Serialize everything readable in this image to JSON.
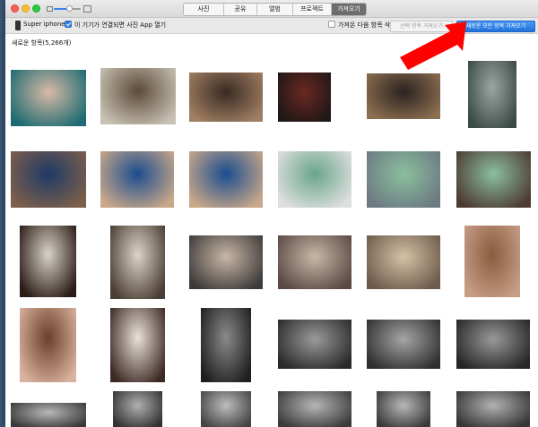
{
  "tabs": [
    "사진",
    "공유",
    "앨범",
    "프로젝트",
    "가져오기"
  ],
  "active_tab": "가져오기",
  "device": {
    "icon": "iphone-icon",
    "name": "Super iphone"
  },
  "open_photos_option": {
    "label": "이 기기가 연결되면 사진 App 열기",
    "checked": true
  },
  "delete_option": {
    "label": "가져온 다음 항목 삭제",
    "checked": false
  },
  "buttons": {
    "import_selected": "선택 항목 가져오기",
    "import_all": "새로운 모든 항목 가져오기"
  },
  "section": {
    "title": "새로운 항목(5,266개)"
  },
  "colors": {
    "accent_blue": "#2f7de1",
    "arrow_red": "#ff0000",
    "close": "#fc5f57",
    "minimize": "#fdbc2e",
    "maximize": "#2ac840"
  },
  "photos": [
    {
      "row": 1,
      "col": 1,
      "subject": "group photo of people in white costumes on a stage",
      "colors": [
        "#d9b9a6",
        "#1d6b72"
      ]
    },
    {
      "row": 1,
      "col": 2,
      "subject": "person holding a large white teddy bear in a room",
      "colors": [
        "#5d4a38",
        "#c7c1b3"
      ]
    },
    {
      "row": 1,
      "col": 3,
      "subject": "woman with curly hair in a dark setting",
      "colors": [
        "#3a2a22",
        "#a07f63"
      ]
    },
    {
      "row": 1,
      "col": 4,
      "subject": "man in dark clothes standing by a red door",
      "colors": [
        "#6a2822",
        "#1f1717"
      ]
    },
    {
      "row": 1,
      "col": 5,
      "subject": "two people at a dark restaurant table with lamps",
      "colors": [
        "#2b2220",
        "#8c6e50"
      ]
    },
    {
      "row": 1,
      "col": 6,
      "subject": "woman posing by a pool outdoors",
      "colors": [
        "#9aa6a2",
        "#3c4a45"
      ]
    },
    {
      "row": 2,
      "col": 1,
      "subject": "man at a desk eating from a red bowl",
      "colors": [
        "#1f3a66",
        "#7d5f4b"
      ]
    },
    {
      "row": 2,
      "col": 2,
      "subject": "man in blue jacket eating from a red bowl",
      "colors": [
        "#1a4d8f",
        "#c9a789"
      ]
    },
    {
      "row": 2,
      "col": 3,
      "subject": "man in blue jacket eating from a red bowl",
      "colors": [
        "#1a4d8f",
        "#c9a789"
      ]
    },
    {
      "row": 2,
      "col": 4,
      "subject": "woman with a green face mask and man selfie",
      "colors": [
        "#6aa58b",
        "#dfdfdf"
      ]
    },
    {
      "row": 2,
      "col": 5,
      "subject": "couple selfie, woman wearing green face mask",
      "colors": [
        "#8bbf9e",
        "#6c7a82"
      ]
    },
    {
      "row": 2,
      "col": 6,
      "subject": "couple selfie, woman wearing green face mask",
      "colors": [
        "#8bbf9e",
        "#4d3a33"
      ]
    },
    {
      "row": 3,
      "col": 1,
      "subject": "woman holding a bouquet of flowers",
      "colors": [
        "#d8d3c8",
        "#2b1c16"
      ]
    },
    {
      "row": 3,
      "col": 2,
      "subject": "person holding a large pastel bouquet",
      "colors": [
        "#dcd4c6",
        "#4a3d33"
      ]
    },
    {
      "row": 3,
      "col": 3,
      "subject": "close-up of pastel rose bouquet with baby's breath",
      "colors": [
        "#c9b7a6",
        "#3d3b3a"
      ]
    },
    {
      "row": 3,
      "col": 4,
      "subject": "close-up of pastel rose bouquet with baby's breath",
      "colors": [
        "#c9b7a6",
        "#5a4944"
      ]
    },
    {
      "row": 3,
      "col": 5,
      "subject": "close-up of pastel rose bouquet with baby's breath",
      "colors": [
        "#d6c2a5",
        "#6d5a4b"
      ]
    },
    {
      "row": 3,
      "col": 6,
      "subject": "woman with long wavy hair selfie",
      "colors": [
        "#8a5c3f",
        "#c79d86"
      ]
    },
    {
      "row": 4,
      "col": 1,
      "subject": "close-up selfie of a woman with long brown hair",
      "colors": [
        "#6b3e2d",
        "#d8b29c"
      ]
    },
    {
      "row": 4,
      "col": 2,
      "subject": "couple selfie in front of a white wall",
      "colors": [
        "#e9e2d8",
        "#3d2a24"
      ]
    },
    {
      "row": 4,
      "col": 3,
      "subject": "black and white photo of a woman in a room",
      "colors": [
        "#8a8a8a",
        "#1f1f1f"
      ]
    },
    {
      "row": 4,
      "col": 4,
      "subject": "black and white photo of a couple sitting",
      "colors": [
        "#9a9a9a",
        "#2a2a2a"
      ]
    },
    {
      "row": 4,
      "col": 5,
      "subject": "black and white photo of a couple in a room",
      "colors": [
        "#a5a5a5",
        "#2f2f2f"
      ]
    },
    {
      "row": 4,
      "col": 6,
      "subject": "black and white photo of a couple sitting",
      "colors": [
        "#999999",
        "#262626"
      ]
    },
    {
      "row": 5,
      "col": 1,
      "subject": "black and white photo of a group",
      "colors": [
        "#b8b8b8",
        "#3a3a3a"
      ]
    },
    {
      "row": 5,
      "col": 2,
      "subject": "black and white photo of a couple",
      "colors": [
        "#b0b0b0",
        "#333333"
      ]
    },
    {
      "row": 5,
      "col": 3,
      "subject": "black and white photo of a room",
      "colors": [
        "#bdbdbd",
        "#444444"
      ]
    },
    {
      "row": 5,
      "col": 4,
      "subject": "black and white photo of a room",
      "colors": [
        "#b6b6b6",
        "#3b3b3b"
      ]
    },
    {
      "row": 5,
      "col": 5,
      "subject": "black and white photo of people",
      "colors": [
        "#b8b8b8",
        "#3a3a3a"
      ]
    },
    {
      "row": 5,
      "col": 6,
      "subject": "black and white photo of people",
      "colors": [
        "#b2b2b2",
        "#363636"
      ]
    }
  ]
}
